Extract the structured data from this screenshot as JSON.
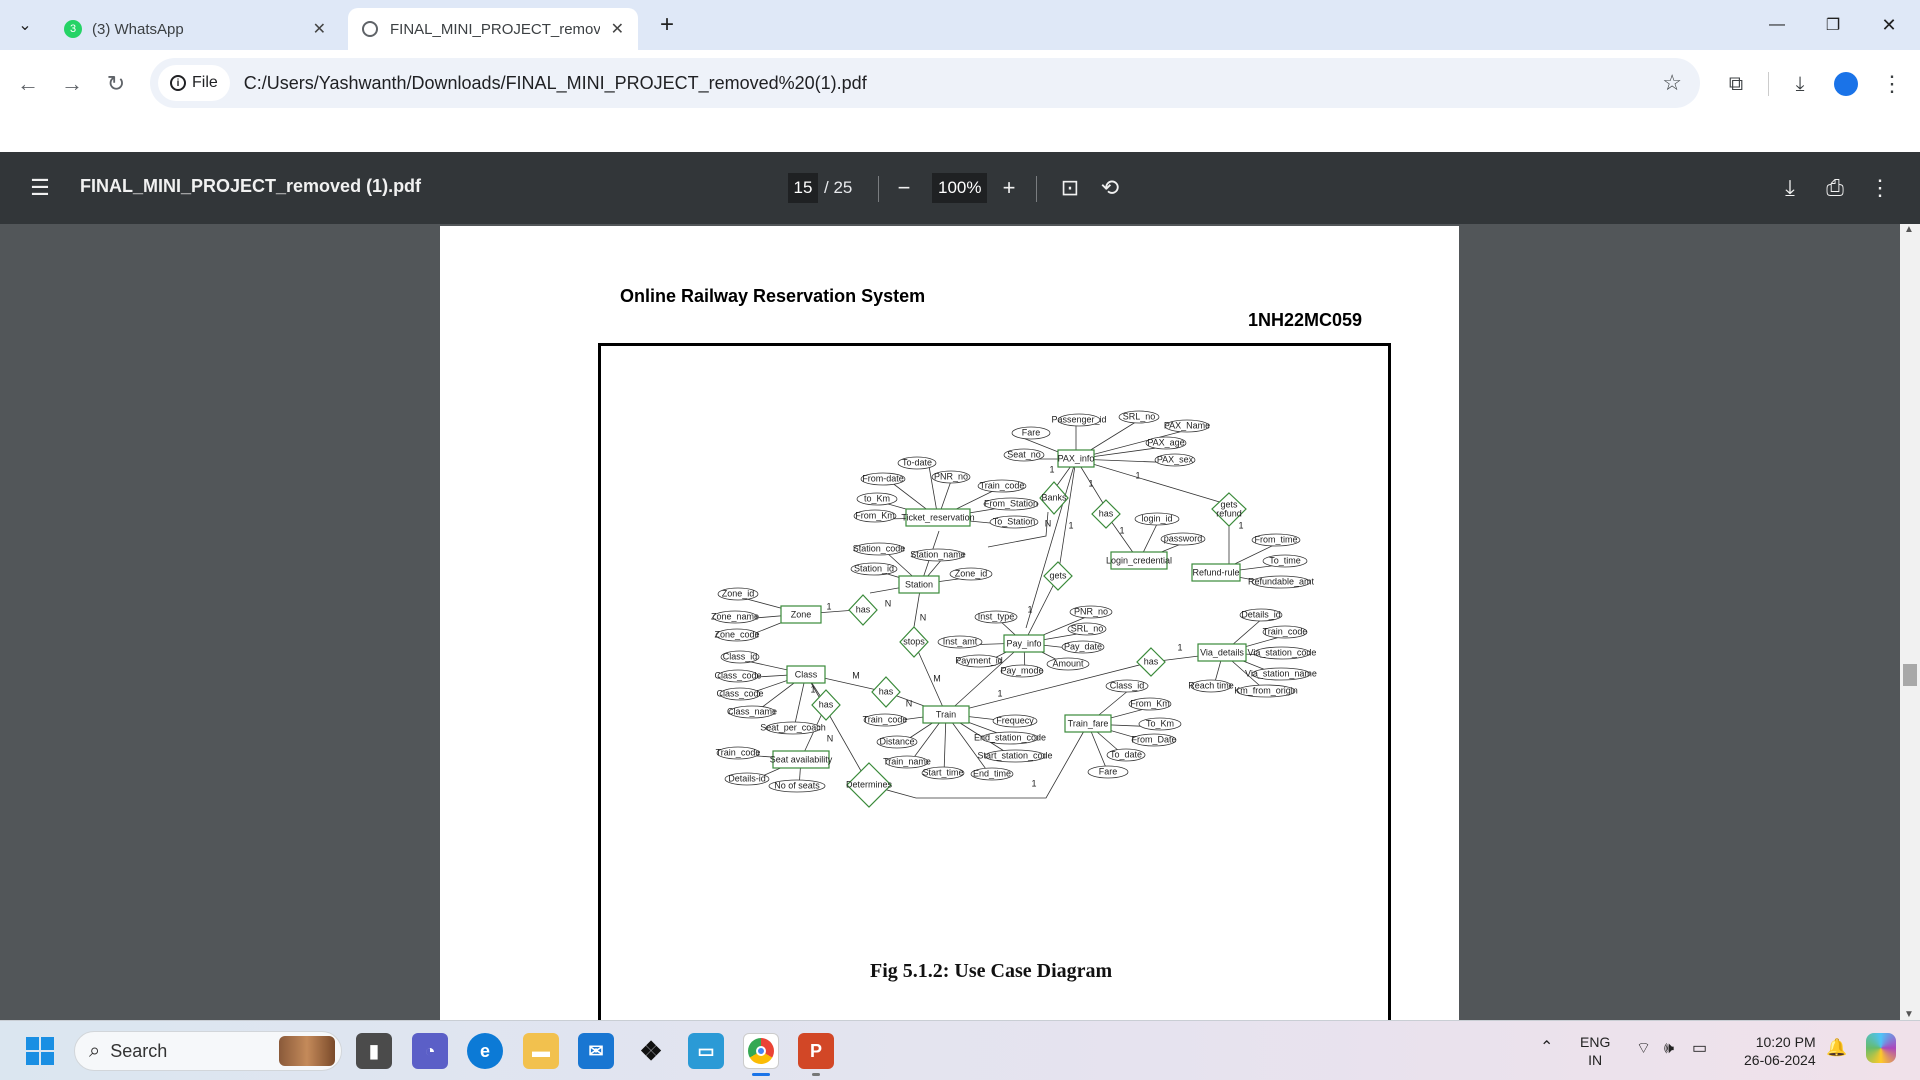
{
  "tabs": [
    {
      "label": "(3) WhatsApp",
      "badge": "3",
      "active": false
    },
    {
      "label": "FINAL_MINI_PROJECT_removed",
      "active": true
    }
  ],
  "omnibox": {
    "scheme_label": "File",
    "url": "C:/Users/Yashwanth/Downloads/FINAL_MINI_PROJECT_removed%20(1).pdf"
  },
  "pdf_viewer": {
    "file_name": "FINAL_MINI_PROJECT_removed (1).pdf",
    "current_page": "15",
    "total_pages": "/ 25",
    "zoom": "100%"
  },
  "document": {
    "title": "Online Railway Reservation System",
    "id": "1NH22MC059",
    "caption": "Fig 5.1.2: Use Case Diagram"
  },
  "er_diagram": {
    "entities": [
      "PAX_info",
      "Ticket_reservation",
      "Station",
      "Zone",
      "Class",
      "Seat availability",
      "Train",
      "Pay_info",
      "Login_credential",
      "Refund-rule",
      "Via_details",
      "Train_fare"
    ],
    "relationships": [
      "Banks",
      "has",
      "gets refund",
      "gets",
      "has",
      "stops",
      "has",
      "has",
      "has",
      "Determines"
    ],
    "attributes": [
      "Passenger_id",
      "SRL_no",
      "PAX_Name",
      "PAX_age",
      "PAX_sex",
      "Fare",
      "Seat_no",
      "To-date",
      "From-date",
      "PNR_no",
      "Train_code",
      "to_Km",
      "From_Station",
      "From_Km",
      "To_Station",
      "login_id",
      "password",
      "From_time",
      "To_time",
      "Refundable_amt",
      "Station_code",
      "Station_name",
      "Station_id",
      "Zone_id",
      "Zone_id",
      "Zone_name",
      "Zone_code",
      "Inst_type",
      "PNR_no",
      "SRL_no",
      "Pay_date",
      "Inst_amt",
      "Payment_id",
      "Amount",
      "Pay_mode",
      "Details_id",
      "Train_code",
      "Via_station_code",
      "Via_station_name",
      "Reach time",
      "Km_from_origin",
      "Class_id",
      "Class_code",
      "Class_code",
      "Class_name",
      "Seat_per_coach",
      "Train_code",
      "Distance",
      "Train_name",
      "Start_time",
      "End_time",
      "Frequecy",
      "End_station_code",
      "Start_station_code",
      "Class_id",
      "From_Km",
      "To_Km",
      "From_Date",
      "To_date",
      "Fare",
      "Train_code",
      "Details-id",
      "No of seats"
    ],
    "cardinalities": [
      "1",
      "1",
      "N",
      "1",
      "1",
      "1",
      "1",
      "1",
      "N",
      "N",
      "1",
      "M",
      "N",
      "M",
      "1",
      "N",
      "1",
      "1"
    ]
  },
  "taskbar": {
    "search_placeholder": "Search",
    "language": "ENG",
    "region": "IN",
    "time": "10:20 PM",
    "date": "26-06-2024"
  }
}
